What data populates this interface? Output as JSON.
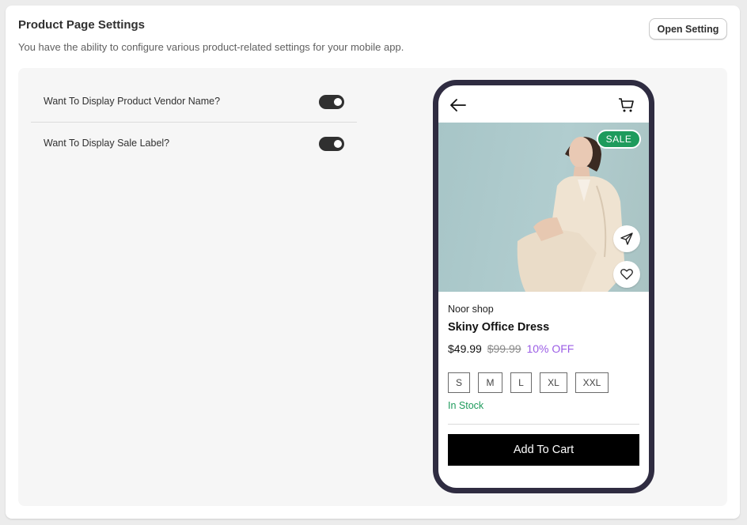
{
  "header": {
    "title": "Product Page Settings",
    "subtitle": "You have the ability to configure various product-related settings for your mobile app.",
    "open_setting_label": "Open Setting"
  },
  "settings": [
    {
      "label": "Want To Display Product Vendor Name?",
      "enabled": true
    },
    {
      "label": "Want To Display Sale Label?",
      "enabled": true
    }
  ],
  "preview": {
    "sale_badge": "SALE",
    "vendor": "Noor shop",
    "product_name": "Skiny Office Dress",
    "price": "$49.99",
    "compare_price": "$99.99",
    "discount": "10% OFF",
    "sizes": [
      "S",
      "M",
      "L",
      "XL",
      "XXL"
    ],
    "stock_status": "In Stock",
    "add_to_cart_label": "Add To Cart",
    "icons": {
      "back": "arrow-left-icon",
      "cart": "cart-icon",
      "share": "send-icon",
      "wishlist": "heart-icon"
    }
  },
  "colors": {
    "toggle_on": "#303030",
    "phone_frame": "#2f2c41",
    "sale_badge": "#1e9b5c",
    "discount": "#9b5de5",
    "in_stock": "#1e9b5c",
    "add_to_cart_bg": "#000000"
  }
}
